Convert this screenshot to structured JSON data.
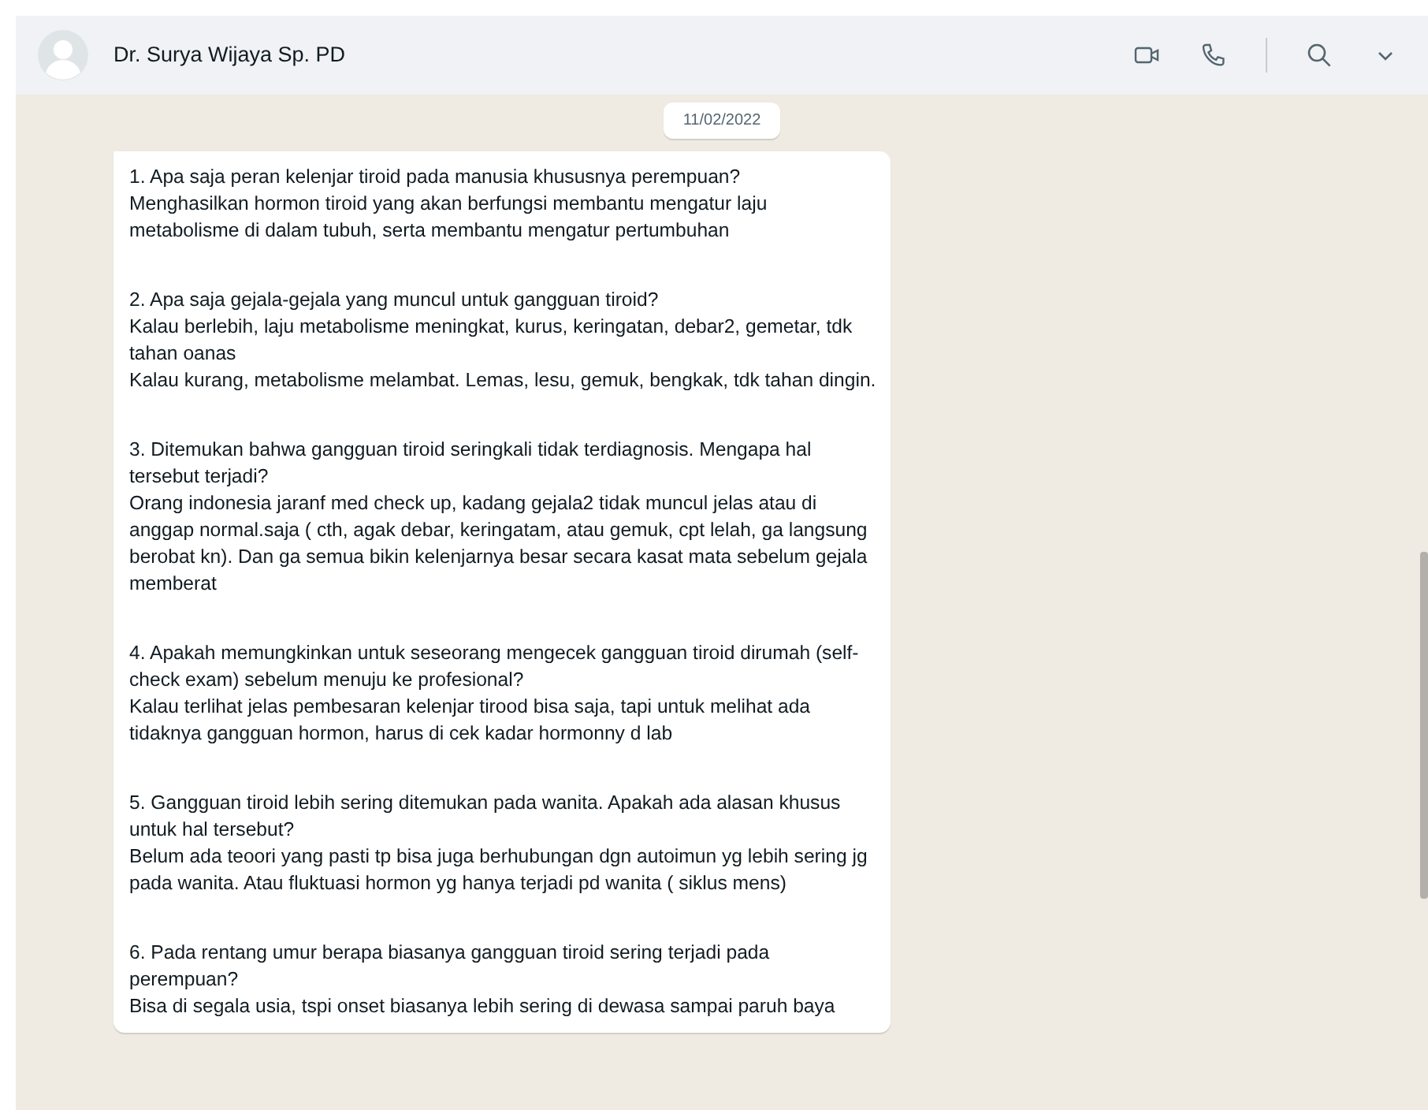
{
  "header": {
    "contact_name": "Dr. Surya Wijaya Sp. PD"
  },
  "date_divider": "11/02/2022",
  "message": {
    "blocks": [
      {
        "lines": [
          "1. Apa saja peran kelenjar tiroid pada manusia khususnya perempuan?",
          "Menghasilkan hormon tiroid yang akan berfungsi membantu mengatur laju metabolisme di dalam tubuh, serta membantu mengatur pertumbuhan"
        ]
      },
      {
        "lines": [
          "2. Apa saja gejala-gejala yang muncul untuk gangguan tiroid?",
          "Kalau berlebih, laju metabolisme meningkat, kurus, keringatan, debar2, gemetar, tdk tahan oanas",
          "Kalau kurang, metabolisme melambat. Lemas, lesu, gemuk, bengkak, tdk tahan dingin."
        ]
      },
      {
        "lines": [
          "3. Ditemukan bahwa gangguan tiroid seringkali tidak terdiagnosis. Mengapa hal tersebut terjadi?",
          "Orang indonesia jaranf med check up, kadang gejala2 tidak muncul jelas atau di anggap normal.saja ( cth, agak debar, keringatam, atau gemuk, cpt lelah, ga langsung berobat kn). Dan ga semua bikin kelenjarnya besar secara kasat mata sebelum gejala memberat"
        ]
      },
      {
        "lines": [
          "4. Apakah memungkinkan untuk seseorang mengecek gangguan tiroid dirumah (self-check exam) sebelum menuju ke profesional?",
          "Kalau terlihat jelas pembesaran kelenjar tirood bisa saja, tapi untuk melihat ada tidaknya gangguan hormon, harus di cek kadar hormonny d lab"
        ]
      },
      {
        "lines": [
          "5. Gangguan tiroid lebih sering ditemukan pada wanita. Apakah ada alasan khusus untuk hal tersebut?",
          "Belum ada teoori yang pasti  tp bisa juga berhubungan dgn autoimun yg lebih sering jg pada wanita. Atau fluktuasi hormon yg hanya terjadi pd wanita ( siklus mens)"
        ]
      },
      {
        "lines": [
          "6. Pada rentang umur berapa biasanya gangguan tiroid sering terjadi pada perempuan?",
          "Bisa di segala usia, tspi onset biasanya lebih sering di dewasa sampai paruh baya"
        ]
      }
    ]
  }
}
